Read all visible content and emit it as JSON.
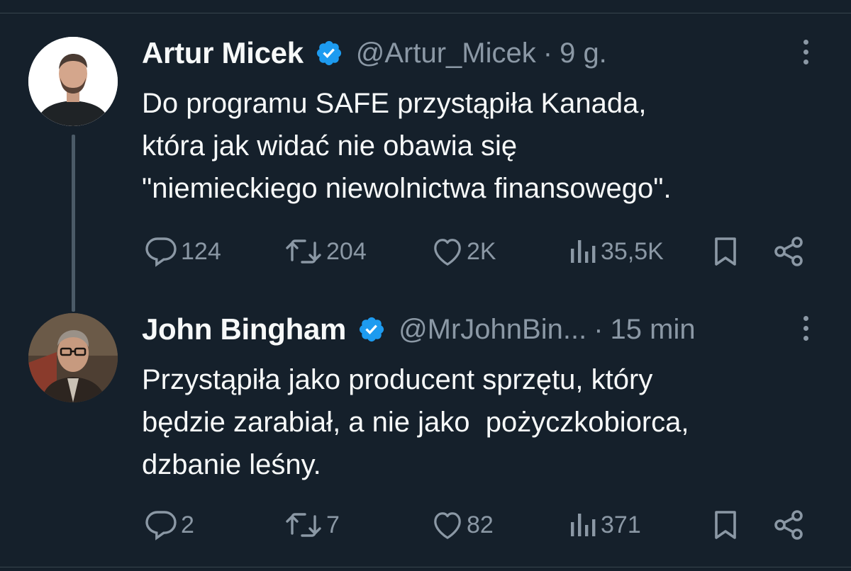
{
  "tweets": [
    {
      "author": {
        "name": "Artur Micek",
        "handle": "@Artur_Micek",
        "verified": true
      },
      "separator": "·",
      "time": "9 g.",
      "text_lines": [
        "Do programu SAFE przystąpiła Kanada,",
        "która jak widać nie obawia się",
        "\"niemieckiego niewolnictwa finansowego\"."
      ],
      "stats": {
        "replies": "124",
        "reposts": "204",
        "likes": "2K",
        "views": "35,5K"
      }
    },
    {
      "author": {
        "name": "John Bingham",
        "handle": "@MrJohnBin...",
        "verified": true
      },
      "separator": "·",
      "time": "15 min",
      "text_lines": [
        "Przystąpiła jako producent sprzętu, który",
        "będzie zarabiał, a nie jako  pożyczkobiorca,",
        "dzbanie leśny."
      ],
      "stats": {
        "replies": "2",
        "reposts": "7",
        "likes": "82",
        "views": "371"
      }
    }
  ],
  "colors": {
    "background": "#15202b",
    "primary_text": "#f7f9f9",
    "secondary_text": "#8b98a5",
    "verified_badge": "#1d9bf0",
    "divider": "#38444d"
  },
  "icons": [
    "verified-badge-icon",
    "more-options-icon",
    "reply-icon",
    "repost-icon",
    "like-icon",
    "views-icon",
    "bookmark-icon",
    "share-icon"
  ]
}
